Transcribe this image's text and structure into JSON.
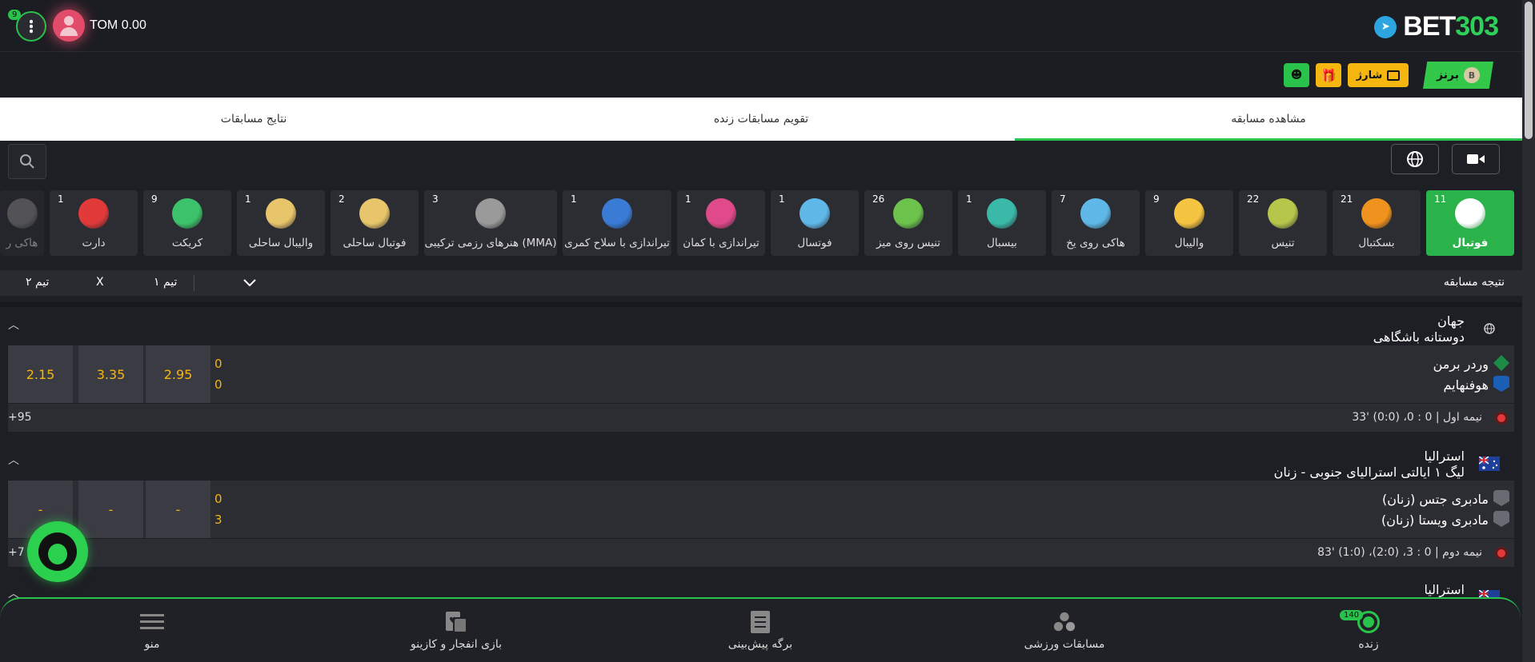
{
  "header": {
    "notif_count": "9",
    "balance": "TOM 0.00",
    "logo_text_a": "BET",
    "logo_text_b": "303"
  },
  "subbar": {
    "rank_label": "برنز",
    "rank_letter": "B",
    "charge_label": "شارژ"
  },
  "tabs": [
    {
      "label": "مشاهده مسابقه",
      "active": true
    },
    {
      "label": "تقویم مسابقات زنده",
      "active": false
    },
    {
      "label": "نتایج مسابقات",
      "active": false
    }
  ],
  "sports": [
    {
      "label": "فوتبال",
      "count": "11",
      "color": "#ffffff"
    },
    {
      "label": "بسکتبال",
      "count": "21",
      "color": "#f0921e"
    },
    {
      "label": "تنیس",
      "count": "22",
      "color": "#b5c64a"
    },
    {
      "label": "والیبال",
      "count": "9",
      "color": "#f5c441"
    },
    {
      "label": "هاکی روی یخ",
      "count": "7",
      "color": "#5fb8e8"
    },
    {
      "label": "بیسبال",
      "count": "1",
      "color": "#3ab9a8"
    },
    {
      "label": "تنیس روی میز",
      "count": "26",
      "color": "#6cc24a"
    },
    {
      "label": "فوتسال",
      "count": "1",
      "color": "#5fb8e8"
    },
    {
      "label": "تیراندازی با کمان",
      "count": "1",
      "color": "#e04a8a"
    },
    {
      "label": "تیراندازی با سلاح کمری",
      "count": "1",
      "color": "#3a7bd5"
    },
    {
      "label": "هنرهای رزمی ترکیبی (MMA)",
      "count": "3",
      "color": "#9a9a9a"
    },
    {
      "label": "فوتبال ساحلی",
      "count": "2",
      "color": "#e8c46a"
    },
    {
      "label": "والیبال ساحلی",
      "count": "1",
      "color": "#e8c46a"
    },
    {
      "label": "کریکت",
      "count": "9",
      "color": "#3cc26a"
    },
    {
      "label": "دارت",
      "count": "1",
      "color": "#e23a3a"
    },
    {
      "label": "هاکی ر",
      "count": "",
      "color": "#888888"
    }
  ],
  "columns": {
    "result": "نتیجه مسابقه",
    "team1": "تیم ۱",
    "x": "X",
    "team2": "تیم ۲"
  },
  "leagues": [
    {
      "country": "جهان",
      "name": "دوستانه باشگاهی",
      "home": "وردر برمن",
      "away": "هوفنهایم",
      "score_home": "0",
      "score_away": "0",
      "odds": [
        "2.95",
        "3.35",
        "2.15"
      ],
      "status": "نیمه اول",
      "status_detail": "0 : 0، (0:0) '33",
      "more": "+95"
    },
    {
      "country": "استرالیا",
      "name": "لیگ ۱ ایالتی استرالیای جنوبی - زنان",
      "home": "مادبری جتس (زنان)",
      "away": "مادبری ویستا (زنان)",
      "score_home": "0",
      "score_away": "3",
      "odds": [
        "-",
        "-",
        "-"
      ],
      "status": "نیمه دوم",
      "status_detail": "0 : 3، (2:0)، (1:0) '83",
      "more": "+7"
    },
    {
      "country": "استرالیا",
      "name": ""
    }
  ],
  "bottomnav": {
    "live_label": "زنده",
    "live_count": "140",
    "sports_label": "مسابقات ورزشی",
    "slip_label": "برگه پیش‌بینی",
    "casino_label": "بازی انفجار و کازینو",
    "menu_label": "منو"
  }
}
